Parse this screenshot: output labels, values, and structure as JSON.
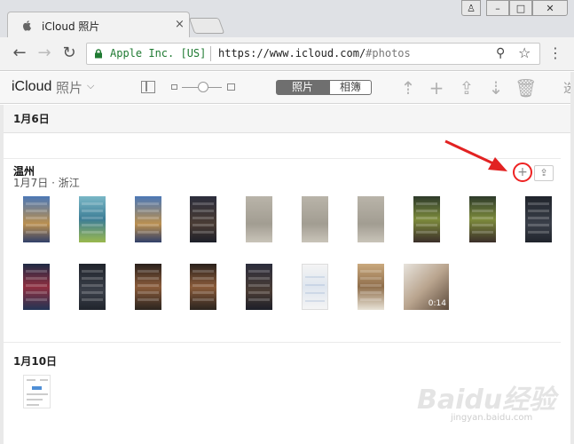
{
  "browser": {
    "tab_title": "iCloud 照片",
    "tab_close": "×",
    "window_buttons": {
      "user": "♙",
      "minimize": "–",
      "maximize": "□",
      "close": "✕"
    },
    "nav": {
      "back": "←",
      "forward": "→",
      "reload": "↻"
    },
    "org_label": "Apple Inc. [US]",
    "url_host": "https://www.icloud.com/",
    "url_path": "#photos",
    "zoom_icon": "⚲",
    "star_icon": "☆",
    "menu_icon": "⋮"
  },
  "app": {
    "title": "iCloud",
    "section": "照片",
    "section_chevron": "⌵",
    "segments": {
      "photos": "照片",
      "albums": "相簿"
    },
    "toolbar_icons": {
      "upload": "⇡",
      "add": "+",
      "share": "⇪",
      "download": "⇣",
      "delete": "🗑"
    },
    "toolbar_text": "选"
  },
  "content": {
    "date_band": "1月6日",
    "moment": {
      "title": "温州",
      "subtitle": "1月7日 · 浙江",
      "add_label": "+",
      "share_label": "⇪"
    },
    "video_duration": "0:14",
    "section2_date": "1月10日"
  },
  "colors": {
    "accent_red": "#e22222",
    "org_green": "#1f7a32",
    "segment_active": "#6f6f6f"
  },
  "watermark": {
    "text": "Baidu经验",
    "sub": "jingyan.baidu.com"
  }
}
